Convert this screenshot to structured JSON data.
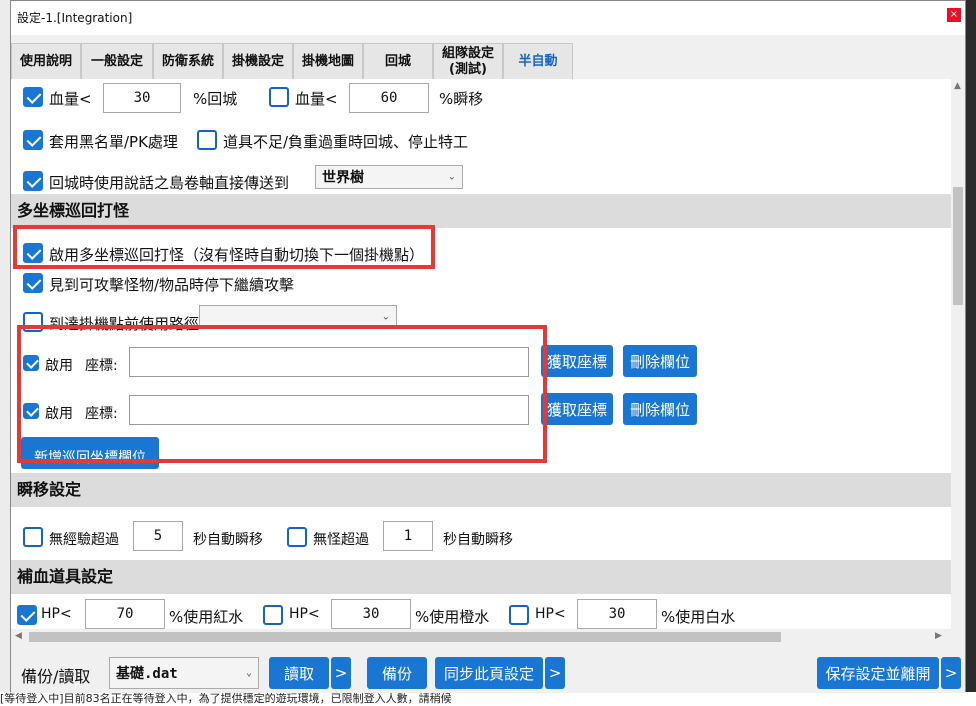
{
  "window": {
    "title": "設定-1.[Integration]",
    "close_label": "×"
  },
  "tabs": [
    {
      "label": "使用說明"
    },
    {
      "label": "一般設定"
    },
    {
      "label": "防衛系統"
    },
    {
      "label": "掛機設定"
    },
    {
      "label": "掛機地圖"
    },
    {
      "label": "回城"
    },
    {
      "label": "組隊設定\n(測試)"
    },
    {
      "label": "半自動"
    }
  ],
  "hp_row": {
    "hp_return_label": "血量<",
    "hp_return_value": "30",
    "hp_return_suffix": "%回城",
    "hp_teleport_label": "血量<",
    "hp_teleport_value": "60",
    "hp_teleport_suffix": "%瞬移"
  },
  "blacklist_row": {
    "blacklist_label": "套用黑名單/PK處理",
    "no_item_label": "道具不足/負重過重時回城、停止特工"
  },
  "return_row": {
    "label": "回城時使用說話之島卷軸直接傳送到",
    "destination": "世界樹"
  },
  "multi_coord": {
    "section_title": "多坐標巡回打怪",
    "enable_label": "啟用多坐標巡回打怪（沒有怪時自動切換下一個掛機點）",
    "stop_label": "見到可攻擊怪物/物品時停下繼續攻擊",
    "path_label": "到達掛機點前使用路徑",
    "path_value": "",
    "entries": [
      {
        "enable_label": "啟用",
        "coord_label": "座標:",
        "coord_value": "",
        "get_label": "獲取座標",
        "delete_label": "刪除欄位"
      },
      {
        "enable_label": "啟用",
        "coord_label": "座標:",
        "coord_value": "",
        "get_label": "獲取座標",
        "delete_label": "刪除欄位"
      }
    ],
    "add_label": "新增巡回坐標欄位"
  },
  "teleport": {
    "section_title": "瞬移設定",
    "no_exp_label": "無經驗超過",
    "no_exp_value": "5",
    "no_exp_suffix": "秒自動瞬移",
    "no_mob_label": "無怪超過",
    "no_mob_value": "1",
    "no_mob_suffix": "秒自動瞬移"
  },
  "potions": {
    "section_title": "補血道具設定",
    "red_label": "HP<",
    "red_value": "70",
    "red_suffix": "%使用紅水",
    "orange_label": "HP<",
    "orange_value": "30",
    "orange_suffix": "%使用橙水",
    "white_label": "HP<",
    "white_value": "30",
    "white_suffix": "%使用白水"
  },
  "bottom_bar": {
    "backup_read_label": "備份/讀取",
    "file_value": "基礎.dat",
    "read_label": "讀取",
    "more_label": ">",
    "backup_label": "備份",
    "sync_label": "同步此頁設定",
    "save_label": "保存設定並離開"
  },
  "background": {
    "status_text": "[等待登入中]目前83名正在等待登入中，為了提供穩定的遊玩環境，已限制登入人數，請稍候"
  },
  "colors": {
    "accent": "#1976d2",
    "highlight_red": "#e53935",
    "tab_active": "#1565c0"
  }
}
